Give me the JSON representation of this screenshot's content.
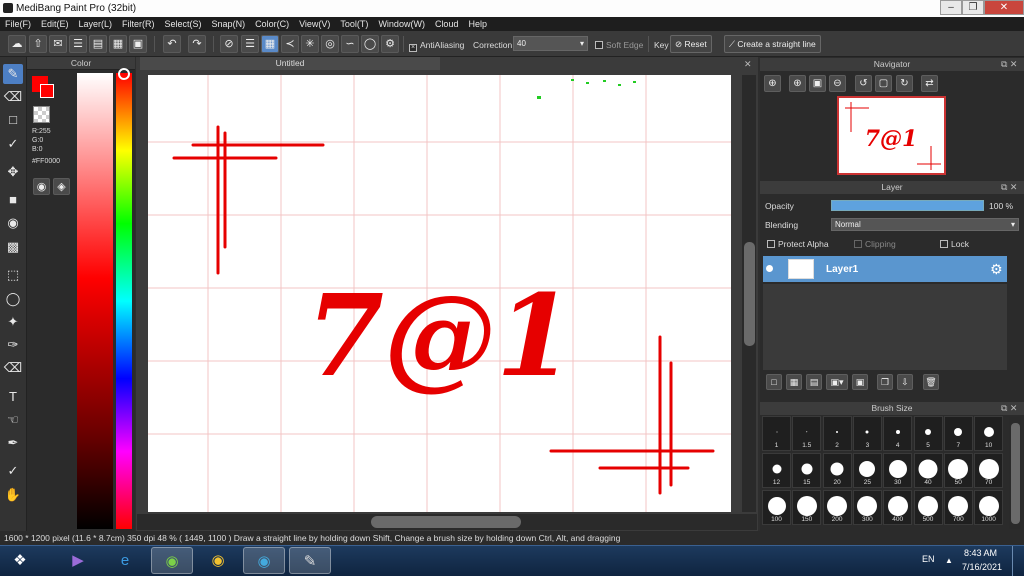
{
  "window": {
    "title": "MediBang Paint Pro (32bit)"
  },
  "menu": [
    "File(F)",
    "Edit(E)",
    "Layer(L)",
    "Filter(R)",
    "Select(S)",
    "Snap(N)",
    "Color(C)",
    "View(V)",
    "Tool(T)",
    "Window(W)",
    "Cloud",
    "Help"
  ],
  "toolbar": {
    "antialiasing": "AntiAliasing",
    "correction_label": "Correction",
    "correction_value": "40",
    "soft_edge": "Soft Edge",
    "key_label": "Key",
    "reset": "Reset",
    "straight_line": "Create a straight line"
  },
  "color_panel": {
    "title": "Color",
    "r": "R:255",
    "g": "G:0",
    "b": "B:0",
    "hex": "#FF0000",
    "current_color": "#FF0000"
  },
  "canvas": {
    "tab": "Untitled",
    "text": "7@1"
  },
  "navigator": {
    "title": "Navigator"
  },
  "layer_panel": {
    "title": "Layer",
    "opacity_label": "Opacity",
    "opacity_value": "100 %",
    "opacity": 1.0,
    "blending_label": "Blending",
    "blending_value": "Normal",
    "protect_alpha": "Protect Alpha",
    "clipping": "Clipping",
    "lock": "Lock",
    "layer_name": "Layer1"
  },
  "brush_size": {
    "title": "Brush Size",
    "sizes": [
      "1",
      "1.5",
      "2",
      "3",
      "4",
      "5",
      "7",
      "10",
      "12",
      "15",
      "20",
      "25",
      "30",
      "40",
      "50",
      "70",
      "100",
      "150",
      "200",
      "300",
      "400",
      "500",
      "700",
      "1000"
    ]
  },
  "status": {
    "text": "1600 * 1200 pixel   (11.6 * 8.7cm)   350 dpi   48 %   ( 1449, 1100 )   Draw a straight line by holding down Shift, Change a brush size by holding down Ctrl, Alt, and dragging"
  },
  "taskbar": {
    "lang": "EN",
    "time": "8:43 AM",
    "date": "7/16/2021"
  }
}
